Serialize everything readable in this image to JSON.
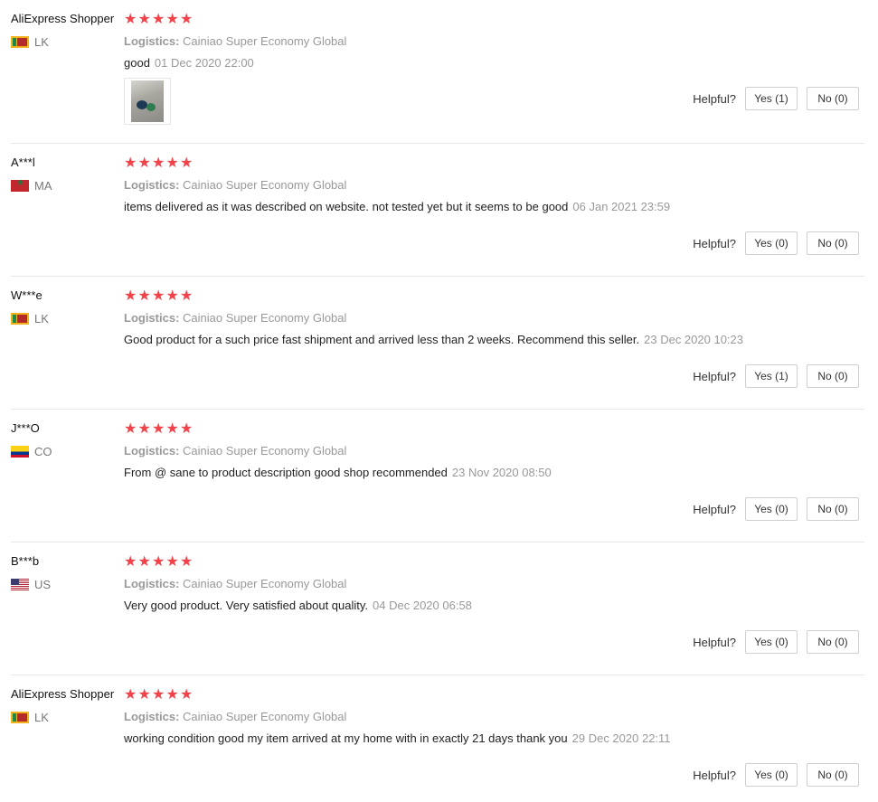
{
  "reviews": [
    {
      "user": "AliExpress Shopper",
      "country": "LK",
      "flag": "lk",
      "stars": 5,
      "logistics_label": "Logistics:",
      "logistics": "Cainiao Super Economy Global",
      "content": "good",
      "date": "01 Dec 2020 22:00",
      "has_photo": true,
      "helpful_label": "Helpful?",
      "yes": "Yes (1)",
      "no": "No (0)"
    },
    {
      "user": "A***l",
      "country": "MA",
      "flag": "ma",
      "stars": 5,
      "logistics_label": "Logistics:",
      "logistics": "Cainiao Super Economy Global",
      "content": "items delivered as it was described on website. not tested yet but it seems to be good",
      "date": "06 Jan 2021 23:59",
      "has_photo": false,
      "helpful_label": "Helpful?",
      "yes": "Yes (0)",
      "no": "No (0)"
    },
    {
      "user": "W***e",
      "country": "LK",
      "flag": "lk",
      "stars": 5,
      "logistics_label": "Logistics:",
      "logistics": "Cainiao Super Economy Global",
      "content": "Good product for a such price fast shipment and arrived less than 2 weeks. Recommend this seller.",
      "date": "23 Dec 2020 10:23",
      "has_photo": false,
      "helpful_label": "Helpful?",
      "yes": "Yes (1)",
      "no": "No (0)"
    },
    {
      "user": "J***O",
      "country": "CO",
      "flag": "co",
      "stars": 5,
      "logistics_label": "Logistics:",
      "logistics": "Cainiao Super Economy Global",
      "content": "From @ sane to product description good shop recommended",
      "date": "23 Nov 2020 08:50",
      "has_photo": false,
      "helpful_label": "Helpful?",
      "yes": "Yes (0)",
      "no": "No (0)"
    },
    {
      "user": "B***b",
      "country": "US",
      "flag": "us",
      "stars": 5,
      "logistics_label": "Logistics:",
      "logistics": "Cainiao Super Economy Global",
      "content": "Very good product. Very satisfied about quality.",
      "date": "04 Dec 2020 06:58",
      "has_photo": false,
      "helpful_label": "Helpful?",
      "yes": "Yes (0)",
      "no": "No (0)"
    },
    {
      "user": "AliExpress Shopper",
      "country": "LK",
      "flag": "lk",
      "stars": 5,
      "logistics_label": "Logistics:",
      "logistics": "Cainiao Super Economy Global",
      "content": "working condition good my item arrived at my home with in exactly 21 days thank you",
      "date": "29 Dec 2020 22:11",
      "has_photo": false,
      "helpful_label": "Helpful?",
      "yes": "Yes (0)",
      "no": "No (0)"
    }
  ],
  "colors": {
    "star": "#f2434b",
    "muted": "#999999",
    "divider": "#e8e8e8"
  }
}
